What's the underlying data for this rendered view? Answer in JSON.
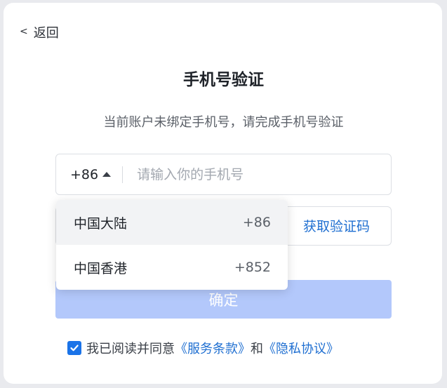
{
  "header": {
    "back_label": "返回",
    "title": "手机号验证",
    "subtitle": "当前账户未绑定手机号，请完成手机号验证"
  },
  "phone": {
    "country_code": "+86",
    "placeholder": "请输入你的手机号",
    "value": ""
  },
  "verification": {
    "get_code_label": "获取验证码"
  },
  "confirm_label": "确定",
  "agreement": {
    "checked": true,
    "prefix": "我已阅读并同意",
    "terms": "《服务条款》",
    "and": "和",
    "privacy": "《隐私协议》"
  },
  "country_dropdown": {
    "options": [
      {
        "name": "中国大陆",
        "code": "+86"
      },
      {
        "name": "中国香港",
        "code": "+852"
      }
    ]
  },
  "colors": {
    "accent": "#1f6fd1",
    "confirm_disabled": "#b3c8fb",
    "checkbox": "#1a73e8"
  }
}
